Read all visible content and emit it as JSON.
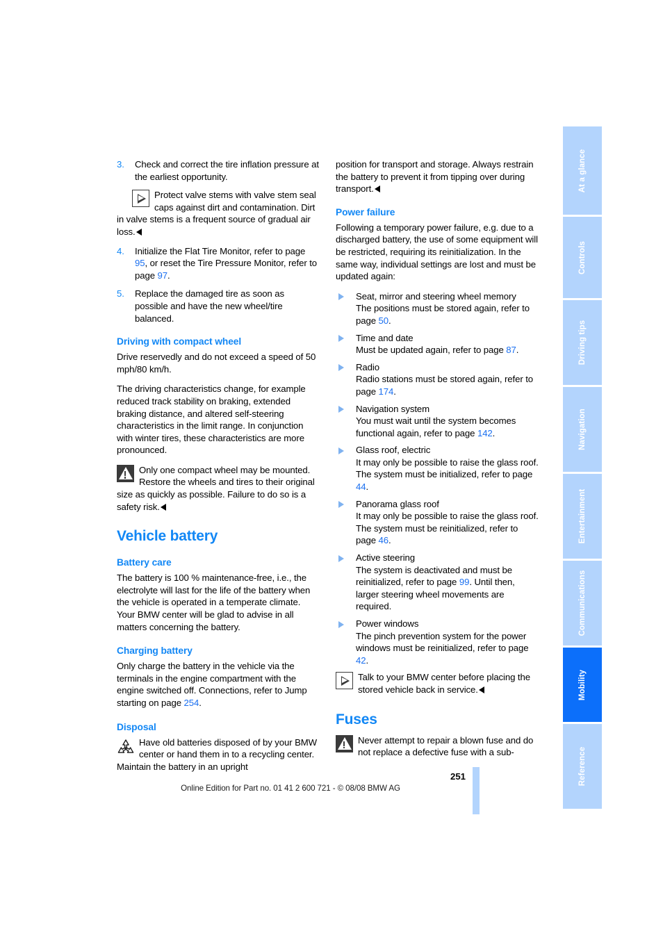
{
  "document": {
    "page_number": "251",
    "footer_text": "Online Edition for Part no. 01 41 2 600 721 - © 08/08 BMW AG"
  },
  "colors": {
    "heading_blue": "#1287f5",
    "link_blue": "#1a6ff0",
    "tab_inactive": "#b3d4fd",
    "tab_active": "#0c6ffa"
  },
  "tabs": [
    {
      "label": "At a glance",
      "active": false
    },
    {
      "label": "Controls",
      "active": false
    },
    {
      "label": "Driving tips",
      "active": false
    },
    {
      "label": "Navigation",
      "active": false
    },
    {
      "label": "Entertainment",
      "active": false
    },
    {
      "label": "Communications",
      "active": false
    },
    {
      "label": "Mobility",
      "active": true
    },
    {
      "label": "Reference",
      "active": false
    }
  ],
  "left_column": {
    "step3": {
      "number": "3.",
      "text": "Check and correct the tire inflation pressure at the earliest opportunity."
    },
    "note_valve": {
      "text": "Protect valve stems with valve stem seal caps against dirt and contamination. Dirt in valve stems is a frequent source of gradual air loss."
    },
    "step4": {
      "number": "4.",
      "part1": "Initialize the Flat Tire Monitor, refer to page ",
      "ref1": "95",
      "part2": ", or reset the Tire Pressure Monitor, refer to page ",
      "ref2": "97",
      "part3": "."
    },
    "step5": {
      "number": "5.",
      "text": "Replace the damaged tire as soon as possible and have the new wheel/tire balanced."
    },
    "compact_wheel": {
      "heading": "Driving with compact wheel",
      "para1": "Drive reservedly and do not exceed a speed of 50 mph/80 km/h.",
      "para2": "The driving characteristics change, for example reduced track stability on braking, extended braking distance, and altered self-steering characteristics in the limit range. In conjunction with winter tires, these characteristics are more pronounced.",
      "warning": "Only one compact wheel may be mounted. Restore the wheels and tires to their original size as quickly as possible. Failure to do so is a safety risk."
    },
    "vehicle_battery": {
      "heading": "Vehicle battery",
      "battery_care": {
        "heading": "Battery care",
        "text": "The battery is 100 % maintenance-free, i.e., the electrolyte will last for the life of the battery when the vehicle is operated in a temperate climate. Your BMW center will be glad to advise in all matters concerning the battery."
      },
      "charging_battery": {
        "heading": "Charging battery",
        "part1": "Only charge the battery in the vehicle via the terminals in the engine compartment with the engine switched off. Connections, refer to Jump starting on page ",
        "ref": "254",
        "part2": "."
      },
      "disposal": {
        "heading": "Disposal",
        "text": "Have old batteries disposed of by your BMW center or hand them in to a recycling center. Maintain the battery in an upright"
      }
    }
  },
  "right_column": {
    "continuation": "position for transport and storage. Always restrain the battery to prevent it from tipping over during transport.",
    "power_failure": {
      "heading": "Power failure",
      "intro": "Following a temporary power failure, e.g. due to a discharged battery, the use of some equipment will be restricted, requiring its reinitialization. In the same way, individual settings are lost and must be updated again:",
      "items": [
        {
          "title": "Seat, mirror and steering wheel memory",
          "part1": "The positions must be stored again, refer to page ",
          "ref": "50",
          "part2": "."
        },
        {
          "title": "Time and date",
          "part1": "Must be updated again, refer to page ",
          "ref": "87",
          "part2": "."
        },
        {
          "title": "Radio",
          "part1": "Radio stations must be stored again, refer to page ",
          "ref": "174",
          "part2": "."
        },
        {
          "title": "Navigation system",
          "part1": "You must wait until the system becomes functional again, refer to page ",
          "ref": "142",
          "part2": "."
        },
        {
          "title": "Glass roof, electric",
          "part1": "It may only be possible to raise the glass roof. The system must be initialized, refer to page ",
          "ref": "44",
          "part2": "."
        },
        {
          "title": "Panorama glass roof",
          "part1": "It may only be possible to raise the glass roof. The system must be reinitialized, refer to page ",
          "ref": "46",
          "part2": "."
        },
        {
          "title": "Active steering",
          "part1": "The system is deactivated and must be reinitialized, refer to page ",
          "ref": "99",
          "part2": ". Until then, larger steering wheel movements are required."
        },
        {
          "title": "Power windows",
          "part1": "The pinch prevention system for the power windows must be reinitialized, refer to page ",
          "ref": "42",
          "part2": "."
        }
      ],
      "note": "Talk to your BMW center before placing the stored vehicle back in service."
    },
    "fuses": {
      "heading": "Fuses",
      "warning": "Never attempt to repair a blown fuse and do not replace a defective fuse with a sub-"
    }
  }
}
